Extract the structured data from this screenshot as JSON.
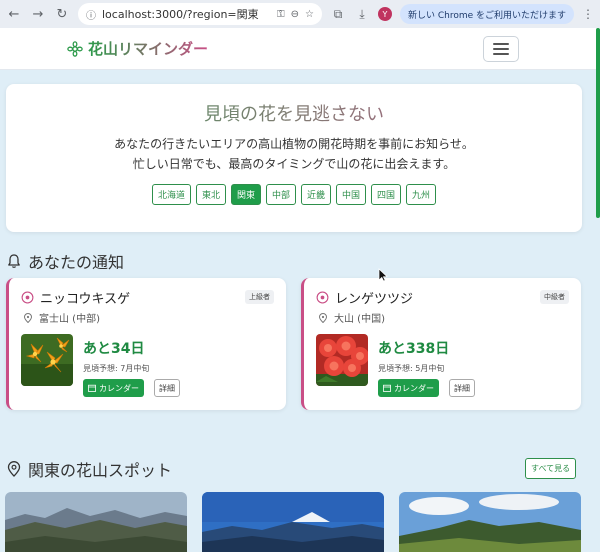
{
  "browser": {
    "url": "localhost:3000/?region=関東",
    "notice": "新しい Chrome をご利用いただけます",
    "menu_glyph": "⋮",
    "avatar_letter": "Y"
  },
  "header": {
    "brand": "花山リマインダー"
  },
  "hero": {
    "title": "見頃の花を見逃さない",
    "desc_line1": "あなたの行きたいエリアの高山植物の開花時期を事前にお知らせ。",
    "desc_line2": "忙しい日常でも、最高のタイミングで山の花に出会えます。",
    "regions": [
      "北海道",
      "東北",
      "関東",
      "中部",
      "近畿",
      "中国",
      "四国",
      "九州"
    ],
    "active_region": "関東"
  },
  "notifications": {
    "title": "あなたの通知",
    "cards": [
      {
        "flower": "ニッコウキスゲ",
        "level": "上級者",
        "location": "富士山 (中部)",
        "countdown": "あと34日",
        "forecast": "見頃予想: 7月中旬",
        "calendar_label": "カレンダー",
        "detail_label": "詳細"
      },
      {
        "flower": "レンゲツツジ",
        "level": "中級者",
        "location": "大山 (中国)",
        "countdown": "あと338日",
        "forecast": "見頃予想: 5月中旬",
        "calendar_label": "カレンダー",
        "detail_label": "詳細"
      }
    ]
  },
  "spots": {
    "title": "関東の花山スポット",
    "see_all": "すべて見る"
  },
  "colors": {
    "accent_green": "#1f9d4a",
    "accent_pink": "#c94f86"
  }
}
